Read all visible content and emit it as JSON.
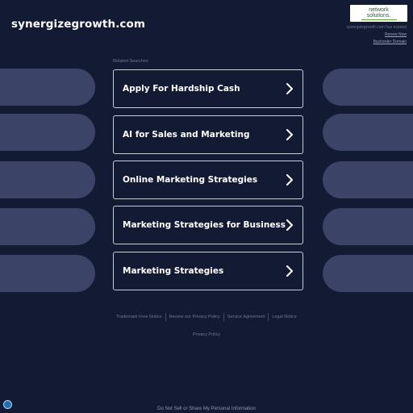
{
  "header": {
    "domain": "synergizegrowth.com"
  },
  "logo": {
    "line1": "network",
    "line2": "solutions."
  },
  "expire_info": {
    "message": "synergizegrowth.com has expired",
    "renew_link": "Renew Now",
    "backorder_link": "Backorder Domain"
  },
  "related": {
    "label": "Related Searches"
  },
  "searches": [
    {
      "label": "Apply For Hardship Cash"
    },
    {
      "label": "AI for Sales and Marketing"
    },
    {
      "label": "Online Marketing Strategies"
    },
    {
      "label": "Marketing Strategies for Business"
    },
    {
      "label": "Marketing Strategies"
    }
  ],
  "footer": {
    "links": [
      "Trademark Free Notice",
      "Review our Privacy Policy",
      "Service Agreement",
      "Legal Notice"
    ],
    "privacy": "Privacy Policy",
    "do_not_sell": "Do Not Sell or Share My Personal Information"
  },
  "colors": {
    "background": "#131a33",
    "ghost": "#3b4467",
    "border": "#c8ccd8"
  }
}
